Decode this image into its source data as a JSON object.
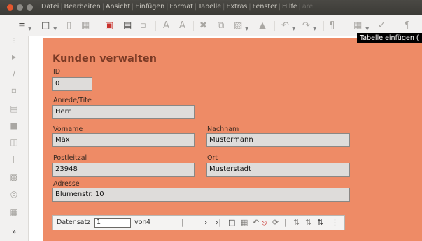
{
  "menu": {
    "items": [
      "Datei",
      "Bearbeiten",
      "Ansicht",
      "Einfügen",
      "Format",
      "Tabelle",
      "Extras",
      "Fenster",
      "Hilfe"
    ],
    "separator": "|",
    "trailing": "are"
  },
  "toolbar": {
    "tooltip": "Tabelle einfügen (",
    "icons": [
      "form-design-icon",
      "new-document-icon",
      "open-icon",
      "save-icon",
      "export-pdf-icon",
      "print-icon",
      "print-preview-icon",
      "font-icon",
      "font-color-icon",
      "cut-icon",
      "copy-icon",
      "paste-icon",
      "format-paintbrush-icon",
      "undo-icon",
      "redo-icon",
      "formatting-marks-icon",
      "insert-table-icon",
      "check-icon",
      "paragraph-icon"
    ]
  },
  "sidebar": {
    "icons": [
      "expand-icon",
      "select-arrow-icon",
      "magic-wand-icon",
      "control-icon",
      "textbox-icon",
      "frame-icon",
      "button-icon",
      "field-icon",
      "listbox-icon",
      "combobox-icon",
      "gallery-icon",
      "more-chevron-icon"
    ]
  },
  "form": {
    "title": "Kunden verwalten",
    "fields": {
      "id": {
        "label": "ID",
        "value": "0"
      },
      "anrede": {
        "label": "Anrede/Tite",
        "value": "Herr"
      },
      "vorname": {
        "label": "Vorname",
        "value": "Max"
      },
      "nachname": {
        "label": "Nachnam",
        "value": "Mustermann"
      },
      "postleitzahl": {
        "label": "Postleitzal",
        "value": "23948"
      },
      "ort": {
        "label": "Ort",
        "value": "Musterstadt"
      },
      "adresse": {
        "label": "Adresse",
        "value": "Blumenstr. 10"
      }
    }
  },
  "navigation": {
    "label": "Datensatz",
    "record": "1",
    "of_label": "von",
    "count": "4"
  },
  "colors": {
    "form_background": "#ee8b66",
    "title_color": "#7a3a25",
    "field_background": "#dedcda",
    "titlebar": "#3b3a36"
  }
}
